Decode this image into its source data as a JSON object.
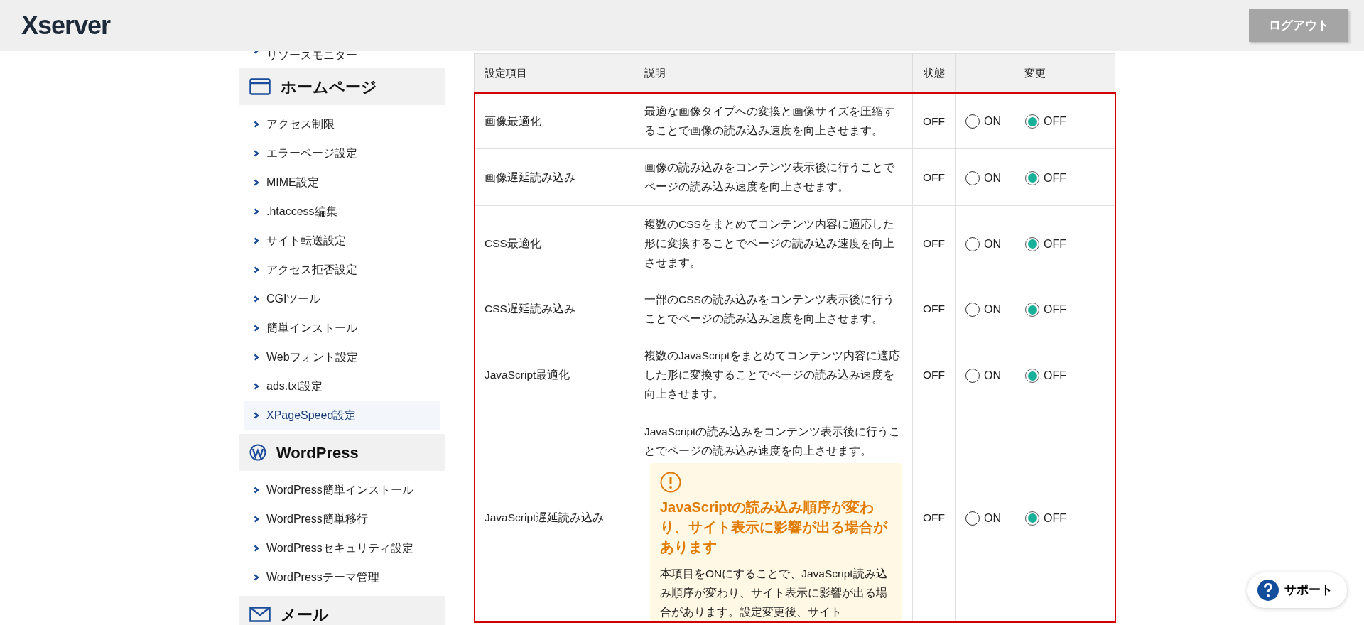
{
  "header": {
    "logo": "Xserver",
    "logout_button": "ログアウト"
  },
  "sidebar": {
    "sections": [
      {
        "kind": "plain",
        "items": [
          {
            "label": "リソースモニター",
            "selected": false
          }
        ]
      },
      {
        "kind": "section",
        "title": "ホームページ",
        "items": [
          {
            "label": "アクセス制限",
            "selected": false
          },
          {
            "label": "エラーページ設定",
            "selected": false
          },
          {
            "label": "MIME設定",
            "selected": false
          },
          {
            "label": ".htaccess編集",
            "selected": false
          },
          {
            "label": "サイト転送設定",
            "selected": false
          },
          {
            "label": "アクセス拒否設定",
            "selected": false
          },
          {
            "label": "CGIツール",
            "selected": false
          },
          {
            "label": "簡単インストール",
            "selected": false
          },
          {
            "label": "Webフォント設定",
            "selected": false
          },
          {
            "label": "ads.txt設定",
            "selected": false
          },
          {
            "label": "XPageSpeed設定",
            "selected": true
          }
        ]
      },
      {
        "kind": "section",
        "title": "WordPress",
        "items": [
          {
            "label": "WordPress簡単インストール",
            "selected": false
          },
          {
            "label": "WordPress簡単移行",
            "selected": false
          },
          {
            "label": "WordPressセキュリティ設定",
            "selected": false
          },
          {
            "label": "WordPressテーマ管理",
            "selected": false
          }
        ]
      },
      {
        "kind": "section",
        "title": "メール"
      }
    ]
  },
  "table": {
    "columns": [
      "設定項目",
      "説明",
      "状態",
      "変更"
    ],
    "rows": [
      {
        "name": "画像最適化",
        "description": "最適な画像タイプへの変換と画像サイズを圧縮することで画像の読み込み速度を向上させます。",
        "status": "OFF",
        "options": [
          {
            "label": "ON",
            "selected": false
          },
          {
            "label": "OFF",
            "selected": true
          }
        ]
      },
      {
        "name": "画像遅延読み込み",
        "description": "画像の読み込みをコンテンツ表示後に行うことでページの読み込み速度を向上させます。",
        "status": "OFF",
        "options": [
          {
            "label": "ON",
            "selected": false
          },
          {
            "label": "OFF",
            "selected": true
          }
        ]
      },
      {
        "name": "CSS最適化",
        "description": "複数のCSSをまとめてコンテンツ内容に適応した形に変換することでページの読み込み速度を向上させます。",
        "status": "OFF",
        "options": [
          {
            "label": "ON",
            "selected": false
          },
          {
            "label": "OFF",
            "selected": true
          }
        ]
      },
      {
        "name": "CSS遅延読み込み",
        "description": "一部のCSSの読み込みをコンテンツ表示後に行うことでページの読み込み速度を向上させます。",
        "status": "OFF",
        "options": [
          {
            "label": "ON",
            "selected": false
          },
          {
            "label": "OFF",
            "selected": true
          }
        ]
      },
      {
        "name": "JavaScript最適化",
        "description": "複数のJavaScriptをまとめてコンテンツ内容に適応した形に変換することでページの読み込み速度を向上させます。",
        "status": "OFF",
        "options": [
          {
            "label": "ON",
            "selected": false
          },
          {
            "label": "OFF",
            "selected": true
          }
        ]
      },
      {
        "name": "JavaScript遅延読み込み",
        "description": "JavaScriptの読み込みをコンテンツ表示後に行うことでページの読み込み速度を向上させます。",
        "warning": {
          "title": "JavaScriptの読み込み順序が変わり、サイト表示に影響が出る場合があります",
          "body": "本項目をONにすることで、JavaScript読み込み順序が変わり、サイト表示に影響が出る場合があります。設定変更後、サイト"
        },
        "status": "OFF",
        "options": [
          {
            "label": "ON",
            "selected": false
          },
          {
            "label": "OFF",
            "selected": true
          }
        ]
      }
    ]
  },
  "support_button": "サポート"
}
